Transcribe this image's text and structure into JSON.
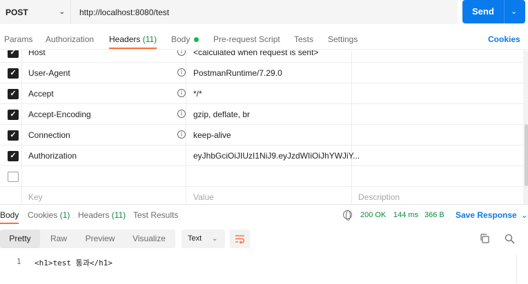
{
  "request": {
    "method": "POST",
    "url": "http://localhost:8080/test",
    "send_label": "Send"
  },
  "req_tabs": {
    "params": "Params",
    "authorization": "Authorization",
    "headers": "Headers",
    "headers_count": "(11)",
    "body": "Body",
    "pre_request": "Pre-request Script",
    "tests": "Tests",
    "settings": "Settings",
    "cookies": "Cookies"
  },
  "headers": [
    {
      "checked": true,
      "key": "Host",
      "value": "<calculated when request is sent>"
    },
    {
      "checked": true,
      "key": "User-Agent",
      "value": "PostmanRuntime/7.29.0"
    },
    {
      "checked": true,
      "key": "Accept",
      "value": "*/*"
    },
    {
      "checked": true,
      "key": "Accept-Encoding",
      "value": "gzip, deflate, br"
    },
    {
      "checked": true,
      "key": "Connection",
      "value": "keep-alive"
    },
    {
      "checked": true,
      "key": "Authorization",
      "value": "eyJhbGciOiJIUzI1NiJ9.eyJzdWIiOiJhYWJiY..."
    }
  ],
  "placeholder": {
    "key": "Key",
    "value": "Value",
    "description": "Description"
  },
  "response_tabs": {
    "body": "Body",
    "cookies": "Cookies",
    "cookies_count": "(1)",
    "headers": "Headers",
    "headers_count": "(11)",
    "test_results": "Test Results"
  },
  "status": {
    "code": "200 OK",
    "time": "144 ms",
    "size": "366 B"
  },
  "save_response": "Save Response",
  "view_modes": [
    "Pretty",
    "Raw",
    "Preview",
    "Visualize"
  ],
  "format": "Text",
  "body_lines": [
    {
      "num": "1",
      "text": "<h1>test 통과</h1>"
    }
  ],
  "colors": {
    "accent": "#ff6c37",
    "send": "#097bed",
    "status": "#0c8a3b"
  }
}
